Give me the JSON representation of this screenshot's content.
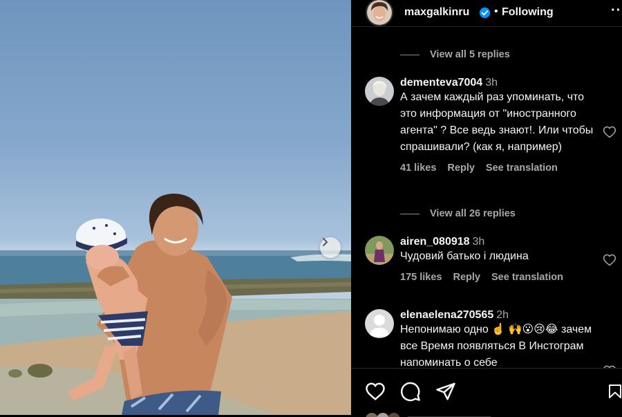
{
  "header": {
    "username": "maxgalkinru",
    "separator": "•",
    "follow_status": "Following",
    "more_icon": "more-horizontal-icon"
  },
  "photo": {
    "next_icon": "chevron-right-icon"
  },
  "comments": {
    "top_view_replies": "View all 5 replies",
    "items": [
      {
        "username": "dementeva7004",
        "time": "3h",
        "text": "А зачем каждый раз упоминать, что это информация от \"иностранного агента\" ? Все ведь знают!. Или чтобы спрашивали? (как я, например)",
        "likes": "41 likes",
        "reply": "Reply",
        "translate": "See translation",
        "replies": "View all 26 replies"
      },
      {
        "username": "airen_080918",
        "time": "3h",
        "text": "Чудовий батько і людина",
        "likes": "175 likes",
        "reply": "Reply",
        "translate": "See translation"
      },
      {
        "username": "elenaelena270565",
        "time": "2h",
        "text": "Непонимаю одно ☝️ 🙌😮😢😂 зачем все Время появляться В Инстограм напоминать о себе"
      }
    ]
  },
  "actions": {
    "like_icon": "heart-icon",
    "comment_icon": "comment-icon",
    "share_icon": "paper-plane-icon",
    "save_icon": "bookmark-icon"
  },
  "colors": {
    "background": "#000000",
    "text": "#f5f5f5",
    "secondary": "#a8a8a8",
    "verified": "#0095f6"
  }
}
